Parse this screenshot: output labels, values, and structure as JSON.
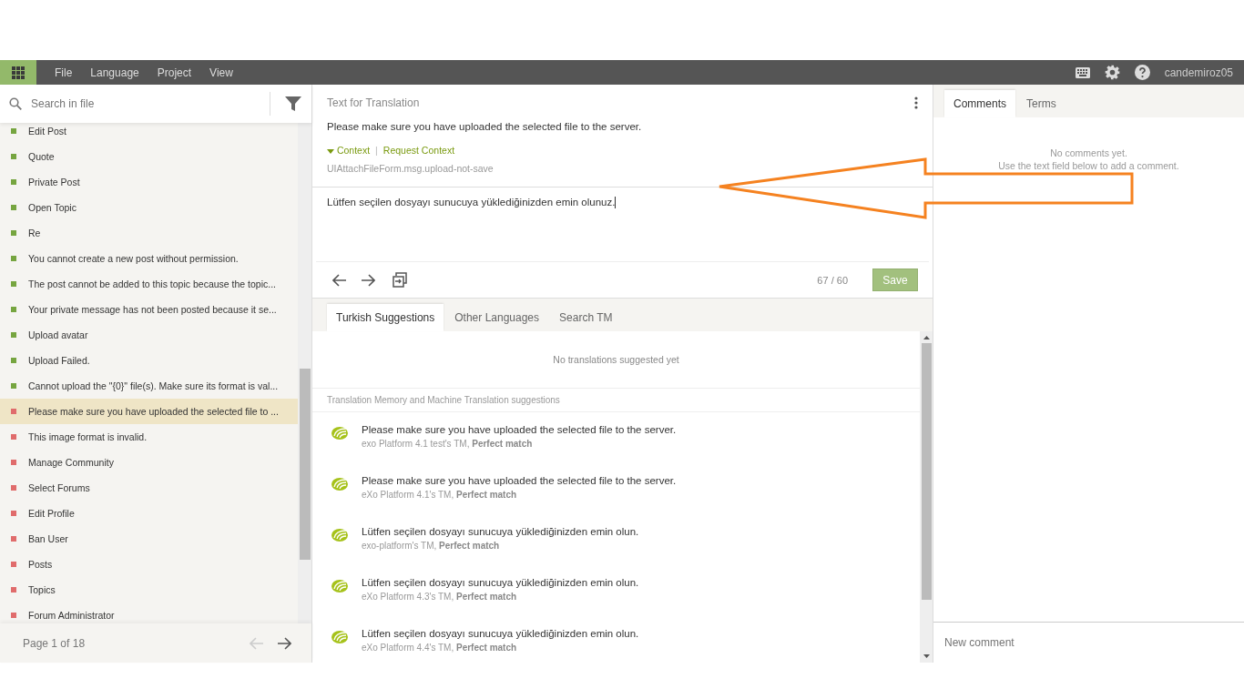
{
  "menubar": {
    "menus": [
      "File",
      "Language",
      "Project",
      "View"
    ],
    "username": "candemiroz05"
  },
  "sidebar": {
    "search": {
      "placeholder": "Search in file"
    },
    "items": [
      {
        "label": "Edit Post",
        "color": "#76a540",
        "selected": false
      },
      {
        "label": "Quote",
        "color": "#76a540",
        "selected": false
      },
      {
        "label": "Private Post",
        "color": "#76a540",
        "selected": false
      },
      {
        "label": "Open Topic",
        "color": "#76a540",
        "selected": false
      },
      {
        "label": "Re",
        "color": "#76a540",
        "selected": false
      },
      {
        "label": "You cannot create a new post without permission.",
        "color": "#76a540",
        "selected": false
      },
      {
        "label": "The post cannot be added to this topic because the topic...",
        "color": "#76a540",
        "selected": false
      },
      {
        "label": "Your private message has not been posted because it se...",
        "color": "#76a540",
        "selected": false
      },
      {
        "label": "Upload avatar",
        "color": "#76a540",
        "selected": false
      },
      {
        "label": "Upload Failed.",
        "color": "#76a540",
        "selected": false
      },
      {
        "label": "Cannot upload the \"{0}\" file(s). Make sure its format is val...",
        "color": "#76a540",
        "selected": false
      },
      {
        "label": "Please make sure you have uploaded the selected file to ...",
        "color": "#e06c6c",
        "selected": true
      },
      {
        "label": "This image format is invalid.",
        "color": "#e06c6c",
        "selected": false
      },
      {
        "label": "Manage Community",
        "color": "#e06c6c",
        "selected": false
      },
      {
        "label": "Select Forums",
        "color": "#e06c6c",
        "selected": false
      },
      {
        "label": "Edit Profile",
        "color": "#e06c6c",
        "selected": false
      },
      {
        "label": "Ban User",
        "color": "#e06c6c",
        "selected": false
      },
      {
        "label": "Posts",
        "color": "#e06c6c",
        "selected": false
      },
      {
        "label": "Topics",
        "color": "#e06c6c",
        "selected": false
      },
      {
        "label": "Forum Administrator",
        "color": "#e06c6c",
        "selected": false
      }
    ],
    "pager": "Page 1 of 18"
  },
  "editor": {
    "title": "Text for Translation",
    "source": "Please make sure you have uploaded the selected file to the server.",
    "context_link": "Context",
    "context_separator": "|",
    "request_context": "Request Context",
    "key": "UIAttachFileForm.msg.upload-not-save",
    "translation": "Lütfen seçilen dosyayı sunucuya yüklediğinizden emin olunuz.",
    "char_count": "67 / 60",
    "save": "Save"
  },
  "suggestions": {
    "tabs": [
      {
        "label": "Turkish Suggestions",
        "selected": true
      },
      {
        "label": "Other Languages",
        "selected": false
      },
      {
        "label": "Search TM",
        "selected": false
      }
    ],
    "empty": "No translations suggested yet",
    "section": "Translation Memory and Machine Translation suggestions",
    "items": [
      {
        "text": "Please make sure you have uploaded the selected file to the server.",
        "source": "exo Platform 4.1 test's TM, ",
        "match": "Perfect match"
      },
      {
        "text": "Please make sure you have uploaded the selected file to the server.",
        "source": "eXo Platform 4.1's TM, ",
        "match": "Perfect match"
      },
      {
        "text": "Lütfen seçilen dosyayı sunucuya yüklediğinizden emin olun.",
        "source": "exo-platform's TM, ",
        "match": "Perfect match"
      },
      {
        "text": "Lütfen seçilen dosyayı sunucuya yüklediğinizden emin olun.",
        "source": "eXo Platform 4.3's TM, ",
        "match": "Perfect match"
      },
      {
        "text": "Lütfen seçilen dosyayı sunucuya yüklediğinizden emin olun.",
        "source": "eXo Platform 4.4's TM, ",
        "match": "Perfect match"
      }
    ]
  },
  "comments": {
    "tabs": [
      {
        "label": "Comments",
        "selected": true
      },
      {
        "label": "Terms",
        "selected": false
      }
    ],
    "empty_lines": [
      "No comments yet.",
      "Use the text field below to add a comment."
    ],
    "input": {
      "placeholder": "New comment"
    }
  }
}
